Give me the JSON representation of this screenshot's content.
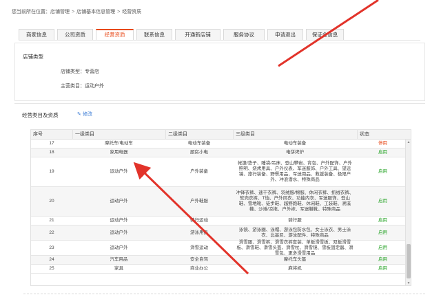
{
  "breadcrumb": [
    "您当前所在位置：",
    "店铺管理",
    "店铺基本信息管理",
    "经营资质"
  ],
  "tabs": [
    "商家信息",
    "公司资质",
    "经营资质",
    "联系信息",
    "开通新店铺",
    "服务协议",
    "申请退出",
    "保证金信息"
  ],
  "active_tab": "经营资质",
  "store_type_section": {
    "title": "店铺类型",
    "store_type_label": "店铺类型：专营店",
    "main_category_label": "主营类目：运动户外"
  },
  "qualification_section": {
    "title": "经营类目及资质",
    "edit_label": "修改"
  },
  "table": {
    "headers": [
      "序号",
      "一级类目",
      "二级类目",
      "三级类目",
      "状态"
    ],
    "rows": [
      {
        "no": "17",
        "l1": "摩托车/电动车",
        "l2": "电动车装备",
        "l3": "电动车装备",
        "status": "停用",
        "on": false
      },
      {
        "no": "18",
        "l1": "家用电器",
        "l2": "厨房小电",
        "l3": "电饼烤炉",
        "status": "启用",
        "on": true
      },
      {
        "no": "19",
        "l1": "运动户外",
        "l2": "户外装备",
        "l3": "帐篷/垫子、睡袋/吊床、登山攀岩、背包、户外配饰、户外照明、烧烤用具、户外仪表、军迷服饰、户外工具、望远镜、旅行装备、野餐用品、军迷用品、救援装备、极限户外、冲浪潜水、特殊商品",
        "status": "启用",
        "on": true
      },
      {
        "no": "20",
        "l1": "运动户外",
        "l2": "户外鞋服",
        "l3": "冲锋衣裤、速干衣裤、羽绒服/棉服、休闲衣裤、抓绒衣裤、软壳衣裤、T恤、户外风衣、功能内衣、军迷服饰、登山鞋、雪地靴、徒步鞋、越野跑鞋、休闲鞋、工装鞋、溯溪鞋、沙滩/凉拖、户外袜、军迷鞋靴、特殊商品",
        "status": "启用",
        "on": true
      },
      {
        "no": "21",
        "l1": "运动户外",
        "l2": "骑行运动",
        "l3": "骑行服",
        "status": "启用",
        "on": true
      },
      {
        "no": "22",
        "l1": "运动户外",
        "l2": "游泳用品",
        "l3": "泳镜、游泳圈、泳帽、游泳包防水包、女士泳衣、男士泳衣、比基尼、游泳配件、特殊商品",
        "status": "启用",
        "on": true
      },
      {
        "no": "23",
        "l1": "运动户外",
        "l2": "滑雪运动",
        "l3": "滑雪服、滑雪裤、滑雪衣裤套装、单板滑雪板、双板滑雪板、滑雪鞋、滑雪头盔、滑雪杖、滑雪镜、雪板固定器、滑雪包、更多滑雪用品",
        "status": "启用",
        "on": true
      },
      {
        "no": "24",
        "l1": "汽车用品",
        "l2": "安全自驾",
        "l3": "摩托车头盔",
        "status": "启用",
        "on": true
      },
      {
        "no": "25",
        "l1": "家具",
        "l2": "商业办公",
        "l3": "麻将机",
        "status": "启用",
        "on": true
      }
    ]
  },
  "colors": {
    "accent": "#e84a1a",
    "enabled": "#2aa52a",
    "link": "#3a7bd5",
    "arrow": "#e2332a"
  }
}
